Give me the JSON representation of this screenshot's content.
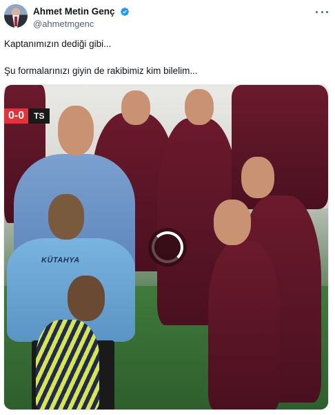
{
  "user": {
    "display_name": "Ahmet Metin Genç",
    "handle": "@ahmetmgenc"
  },
  "icons": {
    "verified": "verified-badge-icon",
    "more": "more-options-icon",
    "loading": "loading-spinner-icon"
  },
  "colors": {
    "verified_blue": "#1d9bf0",
    "text_primary": "#0f1419",
    "text_secondary": "#536471",
    "score_red": "#e7313a"
  },
  "tweet": {
    "line1": "Kaptanımızın dediği gibi...",
    "line2": "Şu formalarınızı giyin de rakibimiz kim bilelim..."
  },
  "media": {
    "scorebug": {
      "score": "0-0",
      "team": "TS"
    },
    "sponsor_text": "KÜTAHYA"
  }
}
